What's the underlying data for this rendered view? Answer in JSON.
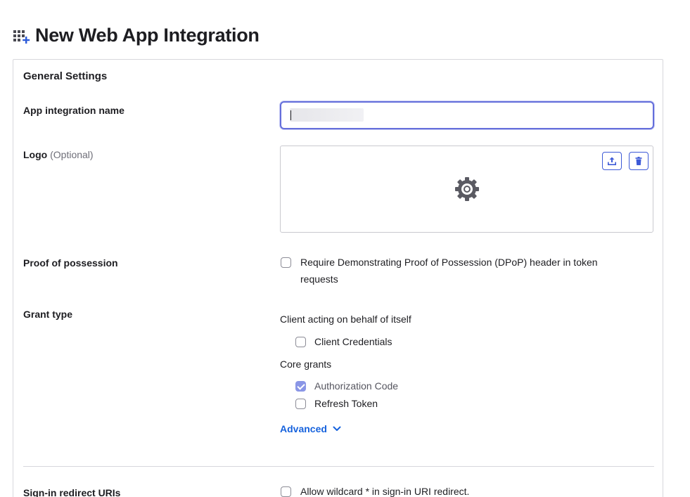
{
  "page": {
    "title": "New Web App Integration",
    "title_icon": "apps-add-icon"
  },
  "general_settings": {
    "title": "General Settings",
    "app_name": {
      "label": "App integration name",
      "value": "",
      "placeholder": ""
    },
    "logo": {
      "label": "Logo",
      "optional": "(Optional)",
      "upload_icon": "upload-icon",
      "delete_icon": "trash-icon",
      "placeholder_icon": "gear-icon"
    },
    "proof_of_possession": {
      "label": "Proof of possession",
      "option_line1": "Require Demonstrating Proof of Possession (DPoP) header in token",
      "option_line2": "requests",
      "checked": false
    },
    "grant_type": {
      "label": "Grant type",
      "client_self_label": "Client acting on behalf of itself",
      "client_credentials": {
        "label": "Client Credentials",
        "checked": false
      },
      "core_grants_label": "Core grants",
      "authorization_code": {
        "label": "Authorization Code",
        "checked": true
      },
      "refresh_token": {
        "label": "Refresh Token",
        "checked": false
      },
      "advanced_label": "Advanced"
    },
    "sign_in_redirect": {
      "label": "Sign-in redirect URIs",
      "wildcard_option": "Allow wildcard * in sign-in URI redirect.",
      "checked": false
    }
  },
  "colors": {
    "accent": "#1662dd",
    "focus_border": "#646edb",
    "checked_fill": "#8a96e6"
  }
}
